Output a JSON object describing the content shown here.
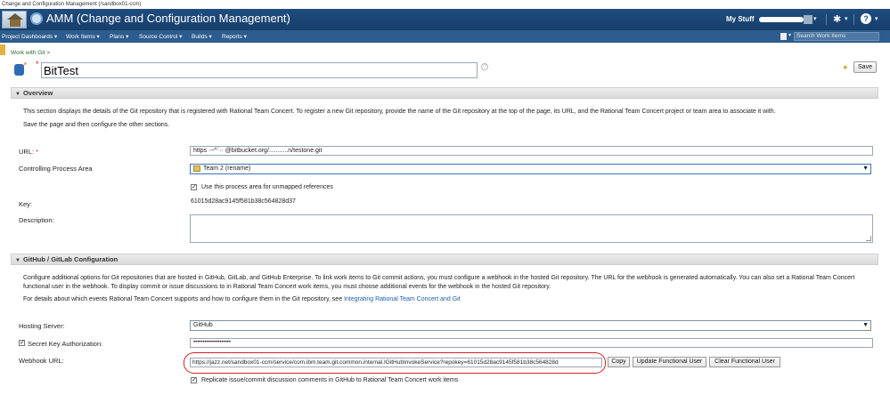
{
  "window": {
    "title": "Change and Configuration Management (/sandbox01-ccm)"
  },
  "app": {
    "title": "AMM (Change and Configuration Management)",
    "my_stuff": "My Stuff"
  },
  "nav": {
    "items": [
      "Project Dashboards",
      "Work Items",
      "Plans",
      "Source Control",
      "Builds",
      "Reports"
    ],
    "search_placeholder": "Search Work Items"
  },
  "breadcrumb": "Work with Git >",
  "editor": {
    "title_value": "BitTest",
    "save_label": "Save",
    "help_glyph": "?"
  },
  "overview": {
    "header": "Overview",
    "description_line1": "This section displays the details of the Git repository that is registered with Rational Team Concert. To register a new Git repository, provide the name of the Git repository at the top of the page, its URL, and the Rational Team Concert project or team area to associate it with.",
    "description_line2": "Save the page and then configure the other sections.",
    "url_label": "URL:",
    "url_value": "https   ·~^`··   @bitbucket.org/...........n/testone.git",
    "process_area_label": "Controlling Process Area",
    "process_area_value": "Team 2 (rename)",
    "use_area_label": "Use this process area for unmapped references",
    "key_label": "Key:",
    "key_value": "61015d28ac9145f581b38c564828d37",
    "description_label": "Description:"
  },
  "github": {
    "header": "GitHub / GitLab Configuration",
    "intro": "Configure additional options for Git repositories that are hosted in GitHub, GitLab, and GitHub Enterprise. To link work items to Git commit actions, you must configure a webhook in the hosted Git repository. The URL for the webhook is generated automatically. You can also set a Rational Team Concert functional user in the webhook. To display commit or issue discussions to in Rational Team Concert work items, you must choose additional events for the webhook in the hosted Git repository.",
    "details_prefix": "For details about which events Rational Team Concert supports and how to configure them in the Git repository, see",
    "details_link": "Integrating Rational Team Concert and Git",
    "hosting_label": "Hosting Server:",
    "hosting_value": "GitHub",
    "secret_label": "Secret Key Authorization:",
    "secret_value": "••••••••••••••••••••",
    "webhook_label": "Webhook URL:",
    "webhook_value": "https://jazz.net/sandbox01-ccm/service/com.ibm.team.git.common.internal.IGitHubInvokeService?repokey=61015d28ac9145f581b38c564828d",
    "copy_label": "Copy",
    "update_label": "Update Functional User",
    "clear_label": "Clear Functional User",
    "replicate_label": "Replicate issue/commit discussion comments in GitHub to Rational Team Concert work items"
  },
  "colors": {
    "appbar": "#1f4d80",
    "navbar": "#2d5c8e",
    "annotation": "#d42020",
    "link": "#1d5fa6"
  },
  "icons": [
    "home-icon",
    "jazz-logo-icon",
    "user-avatar-icon",
    "gear-icon",
    "help-icon",
    "search-icon",
    "git-repository-icon",
    "sparkle-icon"
  ]
}
